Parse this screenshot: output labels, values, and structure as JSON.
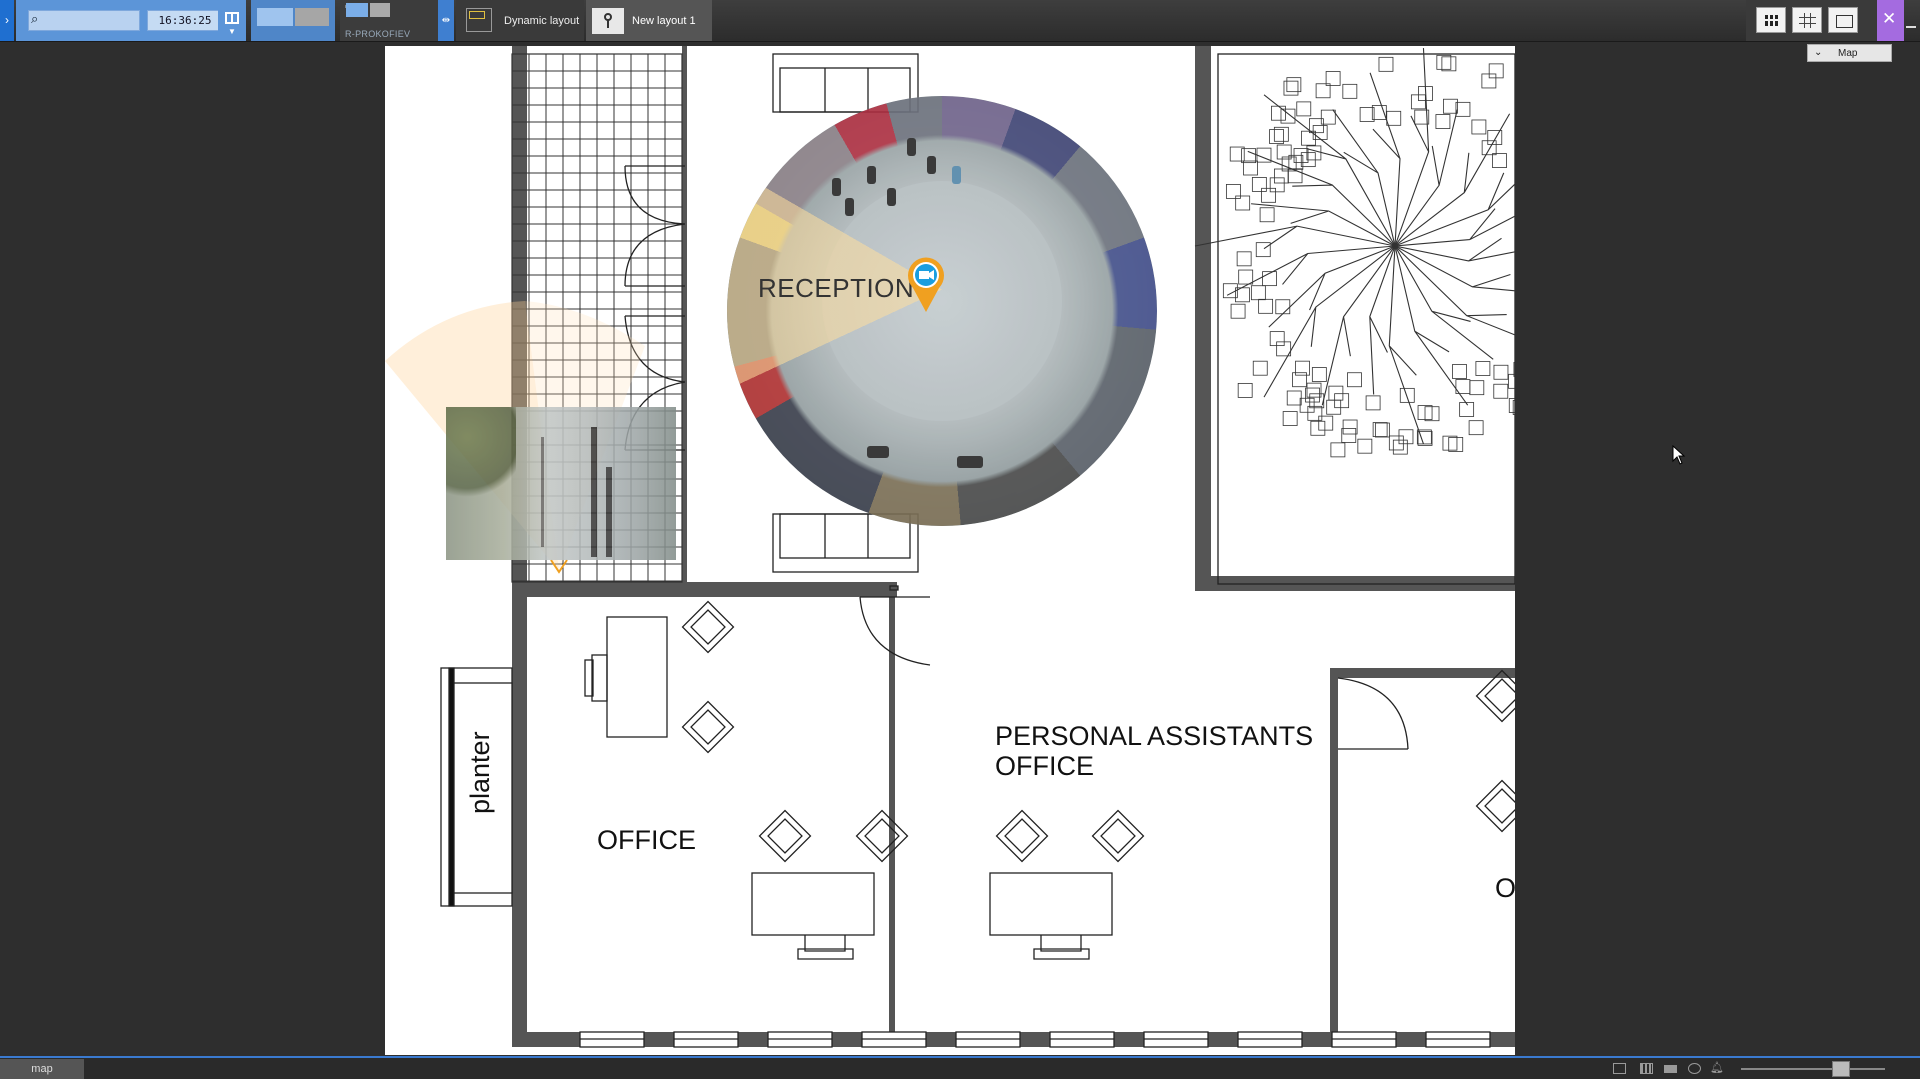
{
  "topbar": {
    "clock": "16:36:25",
    "server_name": "R-PROKOFIEV",
    "tabs": [
      {
        "label": "Dynamic layout"
      },
      {
        "label": "New layout 1"
      }
    ],
    "map_chip_label": "Map"
  },
  "map": {
    "rooms": {
      "reception": "RECEPTION",
      "office": "OFFICE",
      "pa_line1": "PERSONAL ASSISTANTS",
      "pa_line2": "OFFICE",
      "planter": "planter",
      "cut_label": "O"
    }
  },
  "bottombar": {
    "map_tab": "map"
  },
  "colors": {
    "accent": "#3a7ad0",
    "search_bg": "#5c95d8",
    "settings": "#a46be0",
    "camera_pin": "#f0a020",
    "camera_pin_inner": "#1a9ee0"
  },
  "icons": [
    "search-icon",
    "layout-grid-icon",
    "home-icon",
    "camera-icon",
    "map-pin-icon",
    "grid-view-icon",
    "dense-grid-icon",
    "single-view-icon",
    "wrench-icon",
    "minimize-icon",
    "chevron-down-icon"
  ]
}
